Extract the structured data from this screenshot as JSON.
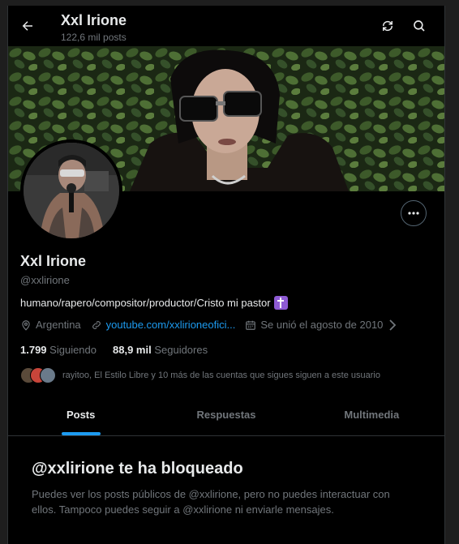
{
  "header": {
    "title": "Xxl Irione",
    "posts_count": "122,6 mil posts"
  },
  "profile": {
    "name": "Xxl Irione",
    "handle": "@xxlirione",
    "bio": "humano/rapero/compositor/productor/Cristo mi pastor",
    "location": "Argentina",
    "website": "youtube.com/xxlirioneofici...",
    "joined": "Se unió el agosto de 2010",
    "following_count": "1.799",
    "following_label": "Siguiendo",
    "followers_count": "88,9 mil",
    "followers_label": "Seguidores",
    "known_followers": "rayitoo, El Estilo Libre y 10 más de las cuentas que sigues siguen a este usuario"
  },
  "tabs": [
    {
      "label": "Posts",
      "active": true
    },
    {
      "label": "Respuestas",
      "active": false
    },
    {
      "label": "Multimedia",
      "active": false
    }
  ],
  "blocked": {
    "title": "@xxlirione te ha bloqueado",
    "text": "Puedes ver los posts públicos de @xxlirione, pero no puedes interactuar con ellos. Tampoco puedes seguir a @xxlirione ni enviarle mensajes."
  },
  "icons": {
    "back": "arrow-left-icon",
    "refresh": "refresh-icon",
    "search": "search-icon",
    "more": "more-icon",
    "location": "location-icon",
    "link": "link-icon",
    "calendar": "calendar-icon",
    "cross_emoji": "latin-cross-icon"
  },
  "colors": {
    "accent": "#1d9bf0",
    "background": "#000000",
    "muted": "#71767b",
    "text": "#e7e9ea"
  }
}
